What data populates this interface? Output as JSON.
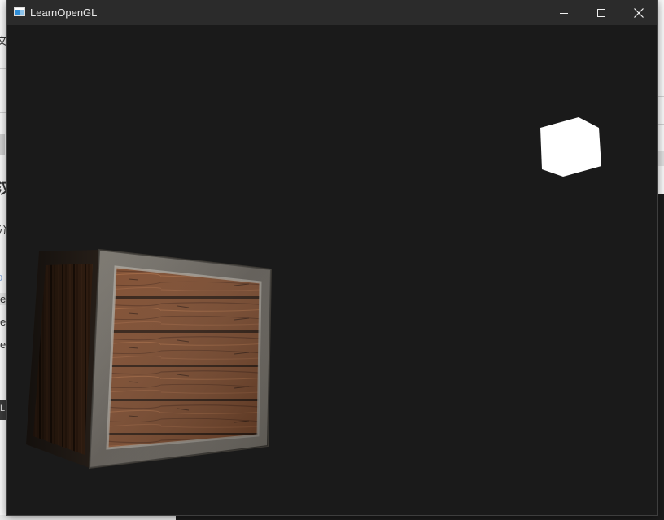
{
  "window": {
    "title": "LearnOpenGL",
    "controls": [
      "minimize",
      "maximize",
      "close"
    ],
    "icon": "opengl-window-icon"
  },
  "viewport": {
    "clear_color": "#1a1a1a",
    "objects": [
      {
        "name": "container-cube",
        "kind": "textured crate"
      },
      {
        "name": "light-cube",
        "kind": "light source",
        "color": "#ffffff"
      }
    ]
  },
  "background_window": {
    "glyphs": [
      "文",
      "分",
      "p",
      "e",
      "e",
      "e",
      "L"
    ]
  },
  "colors": {
    "titlebar": "#2b2b2b",
    "title_text": "#e8e8e8",
    "window_bg": "#1a1a1a",
    "light": "#ffffff",
    "wood": "#7a4526",
    "metal_frame": "#6a6660"
  }
}
